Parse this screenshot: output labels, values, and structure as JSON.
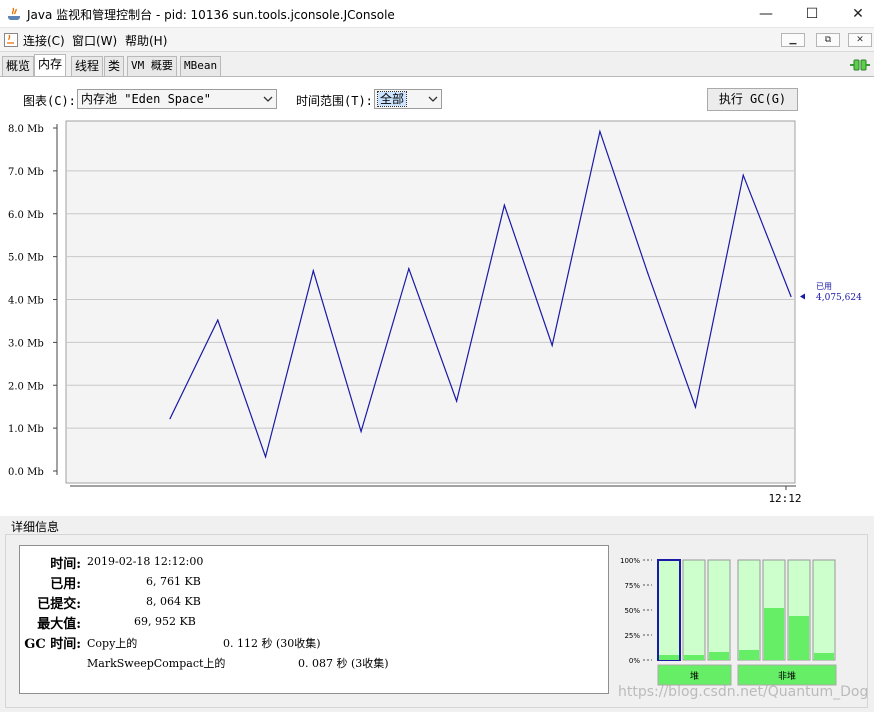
{
  "window": {
    "title": "Java 监视和管理控制台 - pid: 10136 sun.tools.jconsole.JConsole",
    "minimize_glyph": "—",
    "maximize_glyph": "☐",
    "close_glyph": "✕"
  },
  "menu": {
    "items": [
      "连接(C)",
      "窗口(W)",
      "帮助(H)"
    ],
    "mdi_buttons": [
      "▁",
      "⧉",
      "✕"
    ]
  },
  "tabs": [
    {
      "label": "概览",
      "active": false
    },
    {
      "label": "内存",
      "active": true
    },
    {
      "label": "线程",
      "active": false
    },
    {
      "label": "类",
      "active": false
    },
    {
      "label": "VM 概要",
      "active": false
    },
    {
      "label": "MBean",
      "active": false
    }
  ],
  "controls": {
    "chart_label": "图表(C):",
    "chart_value": "内存池 \"Eden Space\"",
    "range_label": "时间范围(T):",
    "range_value": "全部",
    "gc_button": "执行 GC(G)"
  },
  "chart_data": {
    "type": "line",
    "ylim": [
      0,
      8
    ],
    "y_ticks": [
      "0.0 Mb",
      "1.0 Mb",
      "2.0 Mb",
      "3.0 Mb",
      "4.0 Mb",
      "5.0 Mb",
      "6.0 Mb",
      "7.0 Mb",
      "8.0 Mb"
    ],
    "x_tick": "12:12",
    "series": [
      {
        "name": "已用",
        "color": "#1a1aa6",
        "values": [
          1.22,
          3.52,
          0.33,
          4.67,
          0.92,
          4.72,
          1.63,
          6.2,
          2.93,
          7.92,
          4.62,
          1.49,
          6.9,
          4.07
        ]
      }
    ],
    "legend_label": "已用",
    "legend_value": "4,075,624"
  },
  "details": {
    "title": "详细信息",
    "rows": [
      {
        "key": "时间:",
        "value": "2019-02-18 12:12:00"
      },
      {
        "key": "已用:",
        "value": "6, 761 KB"
      },
      {
        "key": "已提交:",
        "value": "8, 064 KB"
      },
      {
        "key": "最大值:",
        "value": "69, 952 KB"
      }
    ],
    "gc_key": "GC 时间:",
    "gc_rows": [
      {
        "name": "Copy上的",
        "time": "0. 112  秒 (30收集)"
      },
      {
        "name": "MarkSweepCompact上的",
        "time": "0. 087  秒 (3收集)"
      }
    ]
  },
  "pool_bars": {
    "axis_labels": [
      "100%",
      "75%",
      "50%",
      "25%",
      "0%"
    ],
    "heap_label": "堆",
    "nonheap_label": "非堆",
    "heap_levels": [
      0.05,
      0.05,
      0.08
    ],
    "nonheap_levels": [
      0.1,
      0.52,
      0.44,
      0.07
    ],
    "color_used": "#66ee66",
    "color_free": "#ccffcc"
  },
  "watermark": "https://blog.csdn.net/Quantum_Dog"
}
